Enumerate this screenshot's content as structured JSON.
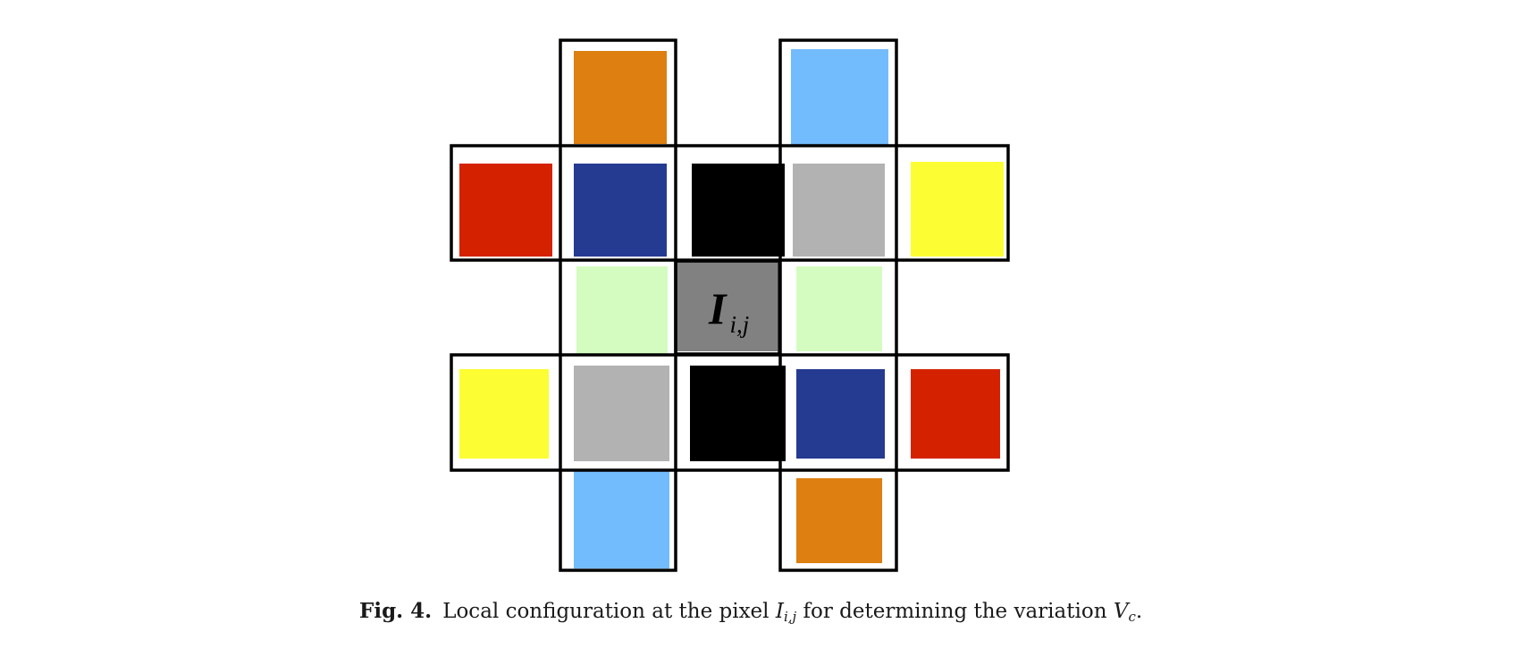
{
  "colors": {
    "orange": "#dd7f11",
    "light_blue": "#72bbfc",
    "red": "#d42201",
    "navy": "#253a91",
    "black": "#000000",
    "gray": "#b2b2b2",
    "yellow": "#fdfd34",
    "light_green": "#d4fcc0",
    "center_gray": "#818181",
    "frame": "#000000"
  },
  "cells": [
    {
      "name": "top-left-orange-swatch",
      "color": "orange"
    },
    {
      "name": "top-right-light-blue-swatch",
      "color": "light_blue"
    },
    {
      "name": "upper-row-red-swatch",
      "color": "red"
    },
    {
      "name": "upper-row-navy-swatch",
      "color": "navy"
    },
    {
      "name": "upper-row-black-swatch",
      "color": "black"
    },
    {
      "name": "upper-row-gray-swatch",
      "color": "gray"
    },
    {
      "name": "upper-row-yellow-swatch",
      "color": "yellow"
    },
    {
      "name": "middle-left-light-green-swatch",
      "color": "light_green"
    },
    {
      "name": "center-pixel-swatch",
      "color": "center_gray"
    },
    {
      "name": "middle-right-light-green-swatch",
      "color": "light_green"
    },
    {
      "name": "lower-row-yellow-swatch",
      "color": "yellow"
    },
    {
      "name": "lower-row-gray-swatch",
      "color": "gray"
    },
    {
      "name": "lower-row-black-swatch",
      "color": "black"
    },
    {
      "name": "lower-row-navy-swatch",
      "color": "navy"
    },
    {
      "name": "lower-row-red-swatch",
      "color": "red"
    },
    {
      "name": "bottom-left-light-blue-swatch",
      "color": "light_blue"
    },
    {
      "name": "bottom-right-orange-swatch",
      "color": "orange"
    }
  ],
  "center_label": {
    "main": "I",
    "subscript": "i,j"
  },
  "caption": {
    "label": "Fig. 4.",
    "text_before": "Local configuration at the pixel ",
    "pixel_symbol": "I",
    "pixel_subscript": "i,j",
    "text_middle": " for determining the variation ",
    "variation_symbol": "V",
    "variation_subscript": "c",
    "text_end": "."
  }
}
